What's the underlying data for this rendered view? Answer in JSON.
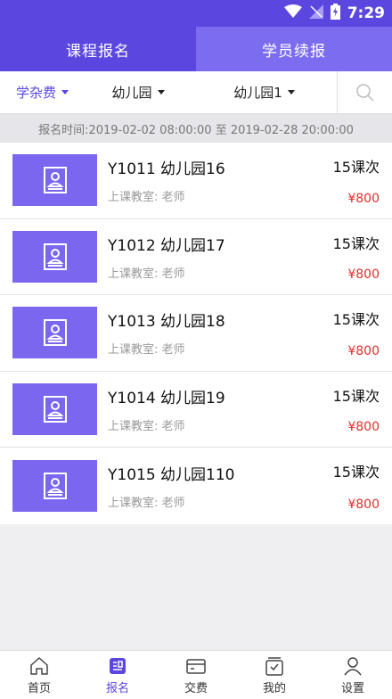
{
  "statusbar": {
    "time": "7:29"
  },
  "tabs": [
    {
      "label": "课程报名",
      "active": true
    },
    {
      "label": "学员续报",
      "active": false
    }
  ],
  "filters": [
    {
      "label": "学杂费"
    },
    {
      "label": "幼儿园"
    },
    {
      "label": "幼儿园1"
    }
  ],
  "time_range": "报名时间:2019-02-02 08:00:00 至 2019-02-28 20:00:00",
  "courses": [
    {
      "title": "Y1011 幼儿园16",
      "subtitle": "上课教室:  老师",
      "count": "15课次",
      "price": "¥800"
    },
    {
      "title": "Y1012 幼儿园17",
      "subtitle": "上课教室:  老师",
      "count": "15课次",
      "price": "¥800"
    },
    {
      "title": "Y1013 幼儿园18",
      "subtitle": "上课教室:  老师",
      "count": "15课次",
      "price": "¥800"
    },
    {
      "title": "Y1014 幼儿园19",
      "subtitle": "上课教室:  老师",
      "count": "15课次",
      "price": "¥800"
    },
    {
      "title": "Y1015 幼儿园110",
      "subtitle": "上课教室:  老师",
      "count": "15课次",
      "price": "¥800"
    }
  ],
  "nav": [
    {
      "label": "首页",
      "icon": "home-icon"
    },
    {
      "label": "报名",
      "icon": "signup-icon",
      "active": true
    },
    {
      "label": "交费",
      "icon": "wallet-icon"
    },
    {
      "label": "我的",
      "icon": "mine-icon"
    },
    {
      "label": "设置",
      "icon": "person-icon"
    }
  ],
  "colors": {
    "primary": "#5b47e0",
    "primary_light": "#7c6cf0",
    "price": "#e02e2e"
  }
}
